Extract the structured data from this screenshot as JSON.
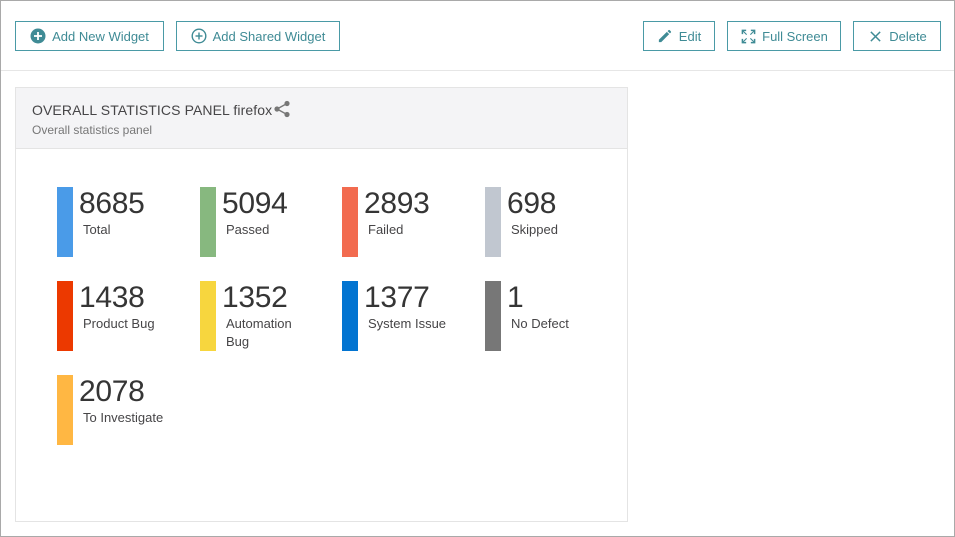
{
  "toolbar": {
    "add_new_widget": "Add New Widget",
    "add_shared_widget": "Add Shared Widget",
    "edit": "Edit",
    "full_screen": "Full Screen",
    "delete": "Delete",
    "accent_color": "#3f8b95"
  },
  "widget": {
    "title": "OVERALL STATISTICS PANEL firefox",
    "subtitle": "Overall statistics panel",
    "stats": [
      {
        "value": "8685",
        "label": "Total",
        "color": "#4a9be8"
      },
      {
        "value": "5094",
        "label": "Passed",
        "color": "#87b87f"
      },
      {
        "value": "2893",
        "label": "Failed",
        "color": "#f26b4f"
      },
      {
        "value": "698",
        "label": "Skipped",
        "color": "#c1c7d0"
      },
      {
        "value": "1438",
        "label": "Product Bug",
        "color": "#ec3900"
      },
      {
        "value": "1352",
        "label": "Automation Bug",
        "color": "#f7d63e"
      },
      {
        "value": "1377",
        "label": "System Issue",
        "color": "#0274d1"
      },
      {
        "value": "1",
        "label": "No Defect",
        "color": "#777777"
      },
      {
        "value": "2078",
        "label": "To Investigate",
        "color": "#ffb743"
      }
    ]
  }
}
